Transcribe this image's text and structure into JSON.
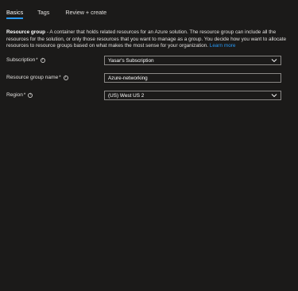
{
  "tabs": [
    {
      "label": "Basics",
      "selected": true
    },
    {
      "label": "Tags",
      "selected": false
    },
    {
      "label": "Review + create",
      "selected": false
    }
  ],
  "info": {
    "heading": "Resource group",
    "text": " - A container that holds related resources for an Azure solution. The resource group can include all the resources for the solution, or only those resources that you want to manage as a group. You decide how you want to allocate resources to resource groups based on what makes the most sense for your organization. ",
    "link": "Learn more"
  },
  "fields": {
    "subscription": {
      "label": "Subscription",
      "required_mark": "*",
      "value": "Yasar's Subscription"
    },
    "resource_group_name": {
      "label": "Resource group name",
      "required_mark": "*",
      "value": "Azure-networking"
    },
    "region": {
      "label": "Region",
      "required_mark": "*",
      "value": "(US) West US 2"
    }
  },
  "icons": {
    "info": "info-circle-icon",
    "dropdown": "chevron-down-icon"
  },
  "colors": {
    "background": "#1b1a19",
    "accent": "#2899f5",
    "border": "#8a8886"
  }
}
